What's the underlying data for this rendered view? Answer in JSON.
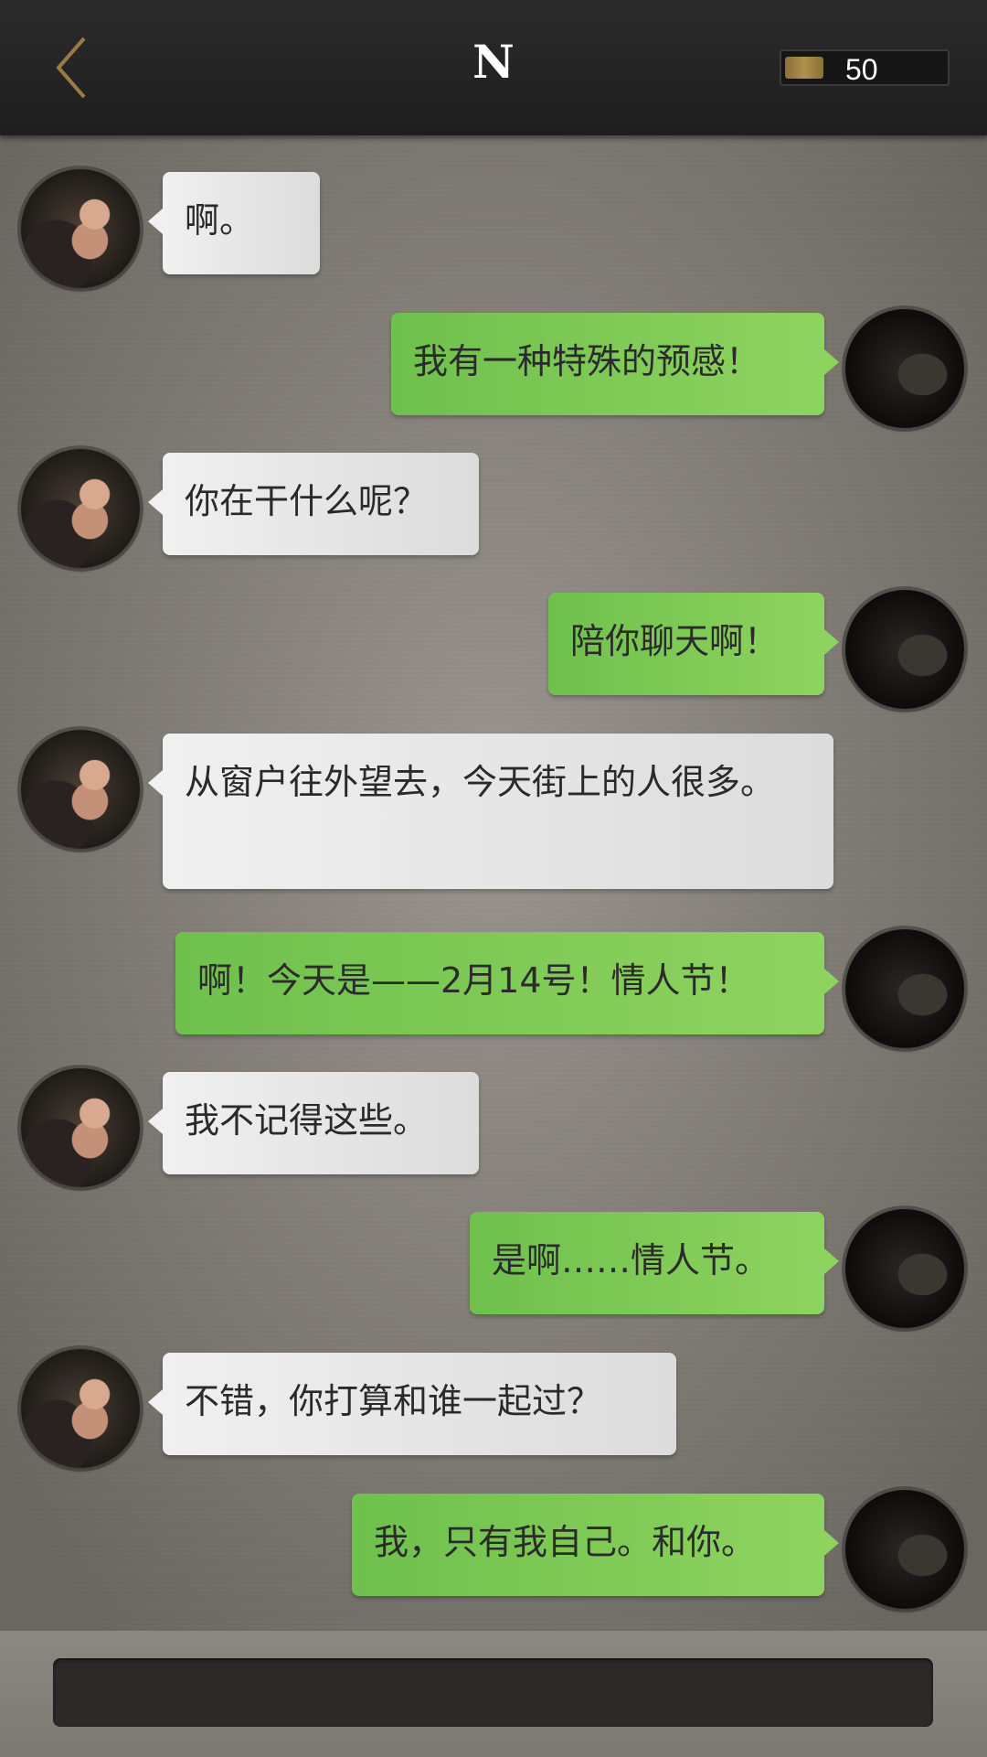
{
  "header": {
    "title": "N",
    "back_icon": "chevron-left-icon",
    "coin_count": "50"
  },
  "messages": [
    {
      "sender": "other",
      "text": "啊。"
    },
    {
      "sender": "self",
      "text": "我有一种特殊的预感！"
    },
    {
      "sender": "other",
      "text": "你在干什么呢？"
    },
    {
      "sender": "self",
      "text": "陪你聊天啊！"
    },
    {
      "sender": "other",
      "text": "从窗户往外望去，今天街上的人很多。"
    },
    {
      "sender": "self",
      "text": "啊！今天是——2月14号！情人节！"
    },
    {
      "sender": "other",
      "text": "我不记得这些。"
    },
    {
      "sender": "self",
      "text": "是啊……情人节。"
    },
    {
      "sender": "other",
      "text": "不错，你打算和谁一起过？"
    },
    {
      "sender": "self",
      "text": "我，只有我自己。和你。"
    }
  ],
  "input": {
    "value": ""
  },
  "colors": {
    "self_bubble": "#7cc956",
    "other_bubble": "#e8e8e8",
    "topbar": "#262626",
    "accent_gold": "#a88a45"
  }
}
